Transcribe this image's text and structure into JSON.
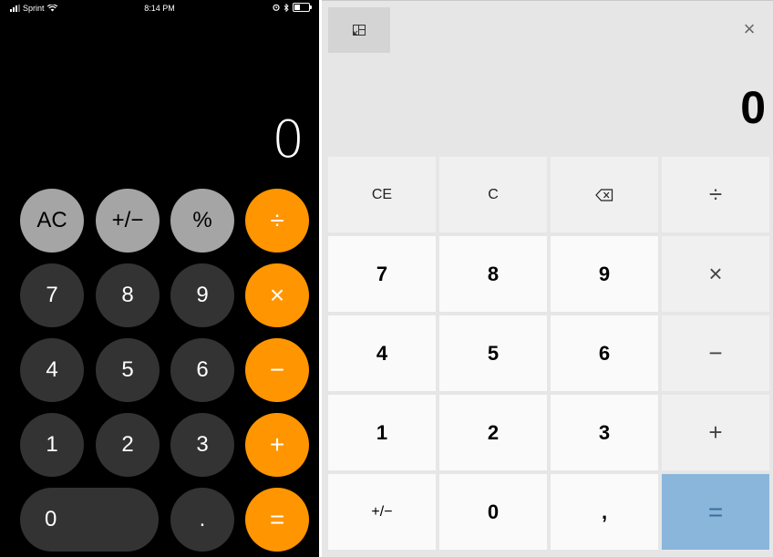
{
  "ios": {
    "status": {
      "carrier": "Sprint",
      "time": "8:14 PM"
    },
    "display": "0",
    "buttons": {
      "ac": "AC",
      "sign": "+/−",
      "percent": "%",
      "divide": "÷",
      "n7": "7",
      "n8": "8",
      "n9": "9",
      "multiply": "×",
      "n4": "4",
      "n5": "5",
      "n6": "6",
      "minus": "−",
      "n1": "1",
      "n2": "2",
      "n3": "3",
      "plus": "+",
      "n0": "0",
      "dot": ".",
      "equals": "="
    },
    "colors": {
      "function_key": "#a5a5a5",
      "digit_key": "#333333",
      "operator_key": "#ff9500",
      "background": "#000000"
    }
  },
  "win": {
    "close_icon": "×",
    "display": "0",
    "buttons": {
      "ce": "CE",
      "c": "C",
      "divide": "÷",
      "n7": "7",
      "n8": "8",
      "n9": "9",
      "multiply": "×",
      "n4": "4",
      "n5": "5",
      "n6": "6",
      "minus": "−",
      "n1": "1",
      "n2": "2",
      "n3": "3",
      "plus": "+",
      "sign": "+/−",
      "n0": "0",
      "decimal": ",",
      "equals": "="
    },
    "icons": {
      "compact": "compact-overlay-icon",
      "backspace": "backspace-icon",
      "close": "close-icon"
    },
    "colors": {
      "equals_key": "#8ab6dc",
      "digit_key": "#fafafa",
      "operator_key": "#f0f0f0",
      "background": "#e6e6e6"
    }
  }
}
